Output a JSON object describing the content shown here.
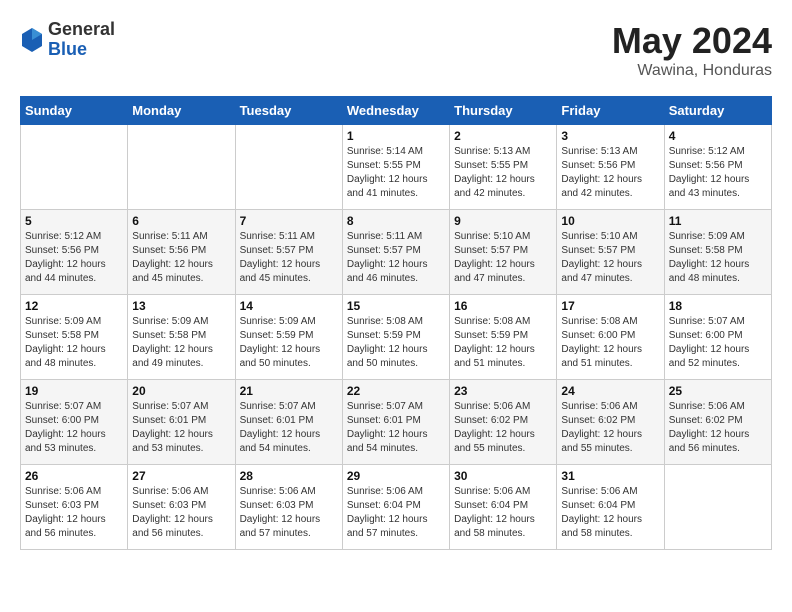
{
  "header": {
    "logo": {
      "general": "General",
      "blue": "Blue"
    },
    "title": "May 2024",
    "location": "Wawina, Honduras"
  },
  "weekdays": [
    "Sunday",
    "Monday",
    "Tuesday",
    "Wednesday",
    "Thursday",
    "Friday",
    "Saturday"
  ],
  "weeks": [
    [
      {
        "day": "",
        "info": ""
      },
      {
        "day": "",
        "info": ""
      },
      {
        "day": "",
        "info": ""
      },
      {
        "day": "1",
        "info": "Sunrise: 5:14 AM\nSunset: 5:55 PM\nDaylight: 12 hours\nand 41 minutes."
      },
      {
        "day": "2",
        "info": "Sunrise: 5:13 AM\nSunset: 5:55 PM\nDaylight: 12 hours\nand 42 minutes."
      },
      {
        "day": "3",
        "info": "Sunrise: 5:13 AM\nSunset: 5:56 PM\nDaylight: 12 hours\nand 42 minutes."
      },
      {
        "day": "4",
        "info": "Sunrise: 5:12 AM\nSunset: 5:56 PM\nDaylight: 12 hours\nand 43 minutes."
      }
    ],
    [
      {
        "day": "5",
        "info": "Sunrise: 5:12 AM\nSunset: 5:56 PM\nDaylight: 12 hours\nand 44 minutes."
      },
      {
        "day": "6",
        "info": "Sunrise: 5:11 AM\nSunset: 5:56 PM\nDaylight: 12 hours\nand 45 minutes."
      },
      {
        "day": "7",
        "info": "Sunrise: 5:11 AM\nSunset: 5:57 PM\nDaylight: 12 hours\nand 45 minutes."
      },
      {
        "day": "8",
        "info": "Sunrise: 5:11 AM\nSunset: 5:57 PM\nDaylight: 12 hours\nand 46 minutes."
      },
      {
        "day": "9",
        "info": "Sunrise: 5:10 AM\nSunset: 5:57 PM\nDaylight: 12 hours\nand 47 minutes."
      },
      {
        "day": "10",
        "info": "Sunrise: 5:10 AM\nSunset: 5:57 PM\nDaylight: 12 hours\nand 47 minutes."
      },
      {
        "day": "11",
        "info": "Sunrise: 5:09 AM\nSunset: 5:58 PM\nDaylight: 12 hours\nand 48 minutes."
      }
    ],
    [
      {
        "day": "12",
        "info": "Sunrise: 5:09 AM\nSunset: 5:58 PM\nDaylight: 12 hours\nand 48 minutes."
      },
      {
        "day": "13",
        "info": "Sunrise: 5:09 AM\nSunset: 5:58 PM\nDaylight: 12 hours\nand 49 minutes."
      },
      {
        "day": "14",
        "info": "Sunrise: 5:09 AM\nSunset: 5:59 PM\nDaylight: 12 hours\nand 50 minutes."
      },
      {
        "day": "15",
        "info": "Sunrise: 5:08 AM\nSunset: 5:59 PM\nDaylight: 12 hours\nand 50 minutes."
      },
      {
        "day": "16",
        "info": "Sunrise: 5:08 AM\nSunset: 5:59 PM\nDaylight: 12 hours\nand 51 minutes."
      },
      {
        "day": "17",
        "info": "Sunrise: 5:08 AM\nSunset: 6:00 PM\nDaylight: 12 hours\nand 51 minutes."
      },
      {
        "day": "18",
        "info": "Sunrise: 5:07 AM\nSunset: 6:00 PM\nDaylight: 12 hours\nand 52 minutes."
      }
    ],
    [
      {
        "day": "19",
        "info": "Sunrise: 5:07 AM\nSunset: 6:00 PM\nDaylight: 12 hours\nand 53 minutes."
      },
      {
        "day": "20",
        "info": "Sunrise: 5:07 AM\nSunset: 6:01 PM\nDaylight: 12 hours\nand 53 minutes."
      },
      {
        "day": "21",
        "info": "Sunrise: 5:07 AM\nSunset: 6:01 PM\nDaylight: 12 hours\nand 54 minutes."
      },
      {
        "day": "22",
        "info": "Sunrise: 5:07 AM\nSunset: 6:01 PM\nDaylight: 12 hours\nand 54 minutes."
      },
      {
        "day": "23",
        "info": "Sunrise: 5:06 AM\nSunset: 6:02 PM\nDaylight: 12 hours\nand 55 minutes."
      },
      {
        "day": "24",
        "info": "Sunrise: 5:06 AM\nSunset: 6:02 PM\nDaylight: 12 hours\nand 55 minutes."
      },
      {
        "day": "25",
        "info": "Sunrise: 5:06 AM\nSunset: 6:02 PM\nDaylight: 12 hours\nand 56 minutes."
      }
    ],
    [
      {
        "day": "26",
        "info": "Sunrise: 5:06 AM\nSunset: 6:03 PM\nDaylight: 12 hours\nand 56 minutes."
      },
      {
        "day": "27",
        "info": "Sunrise: 5:06 AM\nSunset: 6:03 PM\nDaylight: 12 hours\nand 56 minutes."
      },
      {
        "day": "28",
        "info": "Sunrise: 5:06 AM\nSunset: 6:03 PM\nDaylight: 12 hours\nand 57 minutes."
      },
      {
        "day": "29",
        "info": "Sunrise: 5:06 AM\nSunset: 6:04 PM\nDaylight: 12 hours\nand 57 minutes."
      },
      {
        "day": "30",
        "info": "Sunrise: 5:06 AM\nSunset: 6:04 PM\nDaylight: 12 hours\nand 58 minutes."
      },
      {
        "day": "31",
        "info": "Sunrise: 5:06 AM\nSunset: 6:04 PM\nDaylight: 12 hours\nand 58 minutes."
      },
      {
        "day": "",
        "info": ""
      }
    ]
  ]
}
